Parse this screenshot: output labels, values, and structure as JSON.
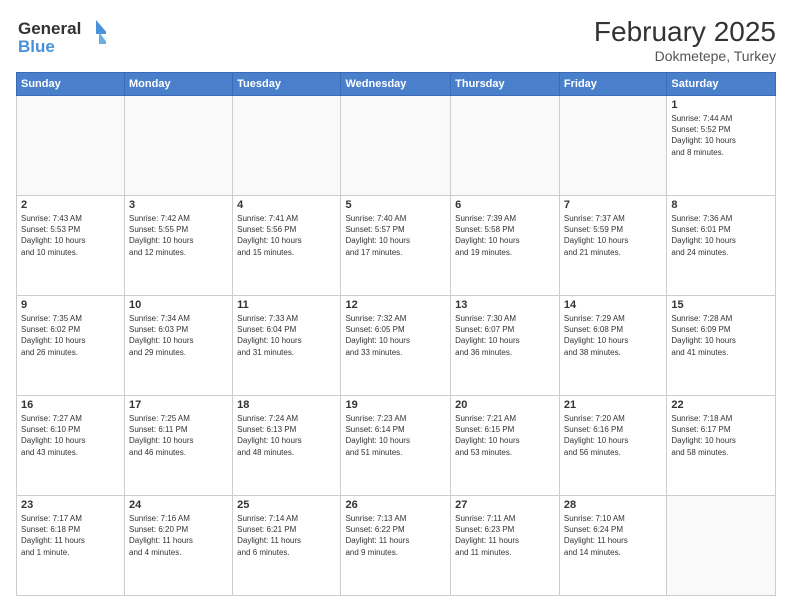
{
  "header": {
    "logo_line1": "General",
    "logo_line2": "Blue",
    "month": "February 2025",
    "location": "Dokmetepe, Turkey"
  },
  "days_of_week": [
    "Sunday",
    "Monday",
    "Tuesday",
    "Wednesday",
    "Thursday",
    "Friday",
    "Saturday"
  ],
  "weeks": [
    [
      {
        "day": "",
        "info": ""
      },
      {
        "day": "",
        "info": ""
      },
      {
        "day": "",
        "info": ""
      },
      {
        "day": "",
        "info": ""
      },
      {
        "day": "",
        "info": ""
      },
      {
        "day": "",
        "info": ""
      },
      {
        "day": "1",
        "info": "Sunrise: 7:44 AM\nSunset: 5:52 PM\nDaylight: 10 hours\nand 8 minutes."
      }
    ],
    [
      {
        "day": "2",
        "info": "Sunrise: 7:43 AM\nSunset: 5:53 PM\nDaylight: 10 hours\nand 10 minutes."
      },
      {
        "day": "3",
        "info": "Sunrise: 7:42 AM\nSunset: 5:55 PM\nDaylight: 10 hours\nand 12 minutes."
      },
      {
        "day": "4",
        "info": "Sunrise: 7:41 AM\nSunset: 5:56 PM\nDaylight: 10 hours\nand 15 minutes."
      },
      {
        "day": "5",
        "info": "Sunrise: 7:40 AM\nSunset: 5:57 PM\nDaylight: 10 hours\nand 17 minutes."
      },
      {
        "day": "6",
        "info": "Sunrise: 7:39 AM\nSunset: 5:58 PM\nDaylight: 10 hours\nand 19 minutes."
      },
      {
        "day": "7",
        "info": "Sunrise: 7:37 AM\nSunset: 5:59 PM\nDaylight: 10 hours\nand 21 minutes."
      },
      {
        "day": "8",
        "info": "Sunrise: 7:36 AM\nSunset: 6:01 PM\nDaylight: 10 hours\nand 24 minutes."
      }
    ],
    [
      {
        "day": "9",
        "info": "Sunrise: 7:35 AM\nSunset: 6:02 PM\nDaylight: 10 hours\nand 26 minutes."
      },
      {
        "day": "10",
        "info": "Sunrise: 7:34 AM\nSunset: 6:03 PM\nDaylight: 10 hours\nand 29 minutes."
      },
      {
        "day": "11",
        "info": "Sunrise: 7:33 AM\nSunset: 6:04 PM\nDaylight: 10 hours\nand 31 minutes."
      },
      {
        "day": "12",
        "info": "Sunrise: 7:32 AM\nSunset: 6:05 PM\nDaylight: 10 hours\nand 33 minutes."
      },
      {
        "day": "13",
        "info": "Sunrise: 7:30 AM\nSunset: 6:07 PM\nDaylight: 10 hours\nand 36 minutes."
      },
      {
        "day": "14",
        "info": "Sunrise: 7:29 AM\nSunset: 6:08 PM\nDaylight: 10 hours\nand 38 minutes."
      },
      {
        "day": "15",
        "info": "Sunrise: 7:28 AM\nSunset: 6:09 PM\nDaylight: 10 hours\nand 41 minutes."
      }
    ],
    [
      {
        "day": "16",
        "info": "Sunrise: 7:27 AM\nSunset: 6:10 PM\nDaylight: 10 hours\nand 43 minutes."
      },
      {
        "day": "17",
        "info": "Sunrise: 7:25 AM\nSunset: 6:11 PM\nDaylight: 10 hours\nand 46 minutes."
      },
      {
        "day": "18",
        "info": "Sunrise: 7:24 AM\nSunset: 6:13 PM\nDaylight: 10 hours\nand 48 minutes."
      },
      {
        "day": "19",
        "info": "Sunrise: 7:23 AM\nSunset: 6:14 PM\nDaylight: 10 hours\nand 51 minutes."
      },
      {
        "day": "20",
        "info": "Sunrise: 7:21 AM\nSunset: 6:15 PM\nDaylight: 10 hours\nand 53 minutes."
      },
      {
        "day": "21",
        "info": "Sunrise: 7:20 AM\nSunset: 6:16 PM\nDaylight: 10 hours\nand 56 minutes."
      },
      {
        "day": "22",
        "info": "Sunrise: 7:18 AM\nSunset: 6:17 PM\nDaylight: 10 hours\nand 58 minutes."
      }
    ],
    [
      {
        "day": "23",
        "info": "Sunrise: 7:17 AM\nSunset: 6:18 PM\nDaylight: 11 hours\nand 1 minute."
      },
      {
        "day": "24",
        "info": "Sunrise: 7:16 AM\nSunset: 6:20 PM\nDaylight: 11 hours\nand 4 minutes."
      },
      {
        "day": "25",
        "info": "Sunrise: 7:14 AM\nSunset: 6:21 PM\nDaylight: 11 hours\nand 6 minutes."
      },
      {
        "day": "26",
        "info": "Sunrise: 7:13 AM\nSunset: 6:22 PM\nDaylight: 11 hours\nand 9 minutes."
      },
      {
        "day": "27",
        "info": "Sunrise: 7:11 AM\nSunset: 6:23 PM\nDaylight: 11 hours\nand 11 minutes."
      },
      {
        "day": "28",
        "info": "Sunrise: 7:10 AM\nSunset: 6:24 PM\nDaylight: 11 hours\nand 14 minutes."
      },
      {
        "day": "",
        "info": ""
      }
    ]
  ]
}
